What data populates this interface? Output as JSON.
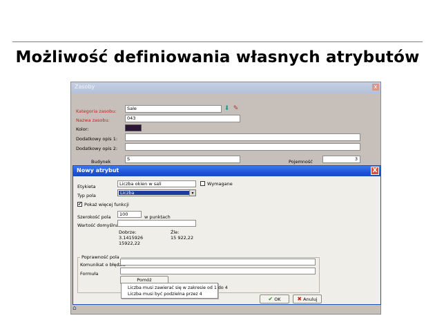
{
  "slide": {
    "title": "Możliwość definiowania własnych atrybutów"
  },
  "outer_window": {
    "title": "Zasoby",
    "close": "x",
    "fields": {
      "kategoria_label": "Kategoria zasobu:",
      "kategoria_value": "Sale",
      "nazwa_label": "Nazwa zasobu:",
      "nazwa_value": "043",
      "kolor_label": "Kolor:",
      "opis1_label": "Dodatkowy opis 1:",
      "opis1_value": "",
      "opis2_label": "Dodatkowy opis 2:",
      "opis2_value": "",
      "budynek_label": "Budynek",
      "budynek_value": "S",
      "pojemnosc_label": "Pojemność",
      "pojemnosc_value": "3"
    },
    "colors": {
      "swatch": "#2a1538"
    }
  },
  "dialog": {
    "title": "Nowy atrybut",
    "close": "X",
    "etykieta_label": "Etykieta",
    "etykieta_value": "Liczba okien w sali",
    "wymagane_label": "Wymagane",
    "typ_pola_label": "Typ pola",
    "typ_pola_value": "Liczba",
    "pokaz_label": "Pokaż więcej funkcji",
    "pokaz_checked": "✔",
    "szerokosc_label": "Szerokość pola",
    "szerokosc_value": "100",
    "w_punktach_label": "w punktach",
    "wartosc_label": "Wartość domyślna",
    "wartosc_value": "",
    "dobrze_label": "Dobrze:",
    "dobrze_ex1": "3.1415926",
    "dobrze_ex2": "15922,22",
    "zle_label": "Źle:",
    "zle_ex1": "15 922,22",
    "poprawnosc_label": "Poprawność pola",
    "komunikat_label": "Komunikat o błędzie",
    "komunikat_value": "",
    "formula_label": "Formuła",
    "formula_value": "",
    "pomoc_button": "Pomóż",
    "hints": [
      "Liczba musi zawierać się w zakresie od 1 do 4",
      "Liczba musi być podzielna przez 4"
    ],
    "ok_button": "OK",
    "anuluj_button": "Anuluj"
  }
}
